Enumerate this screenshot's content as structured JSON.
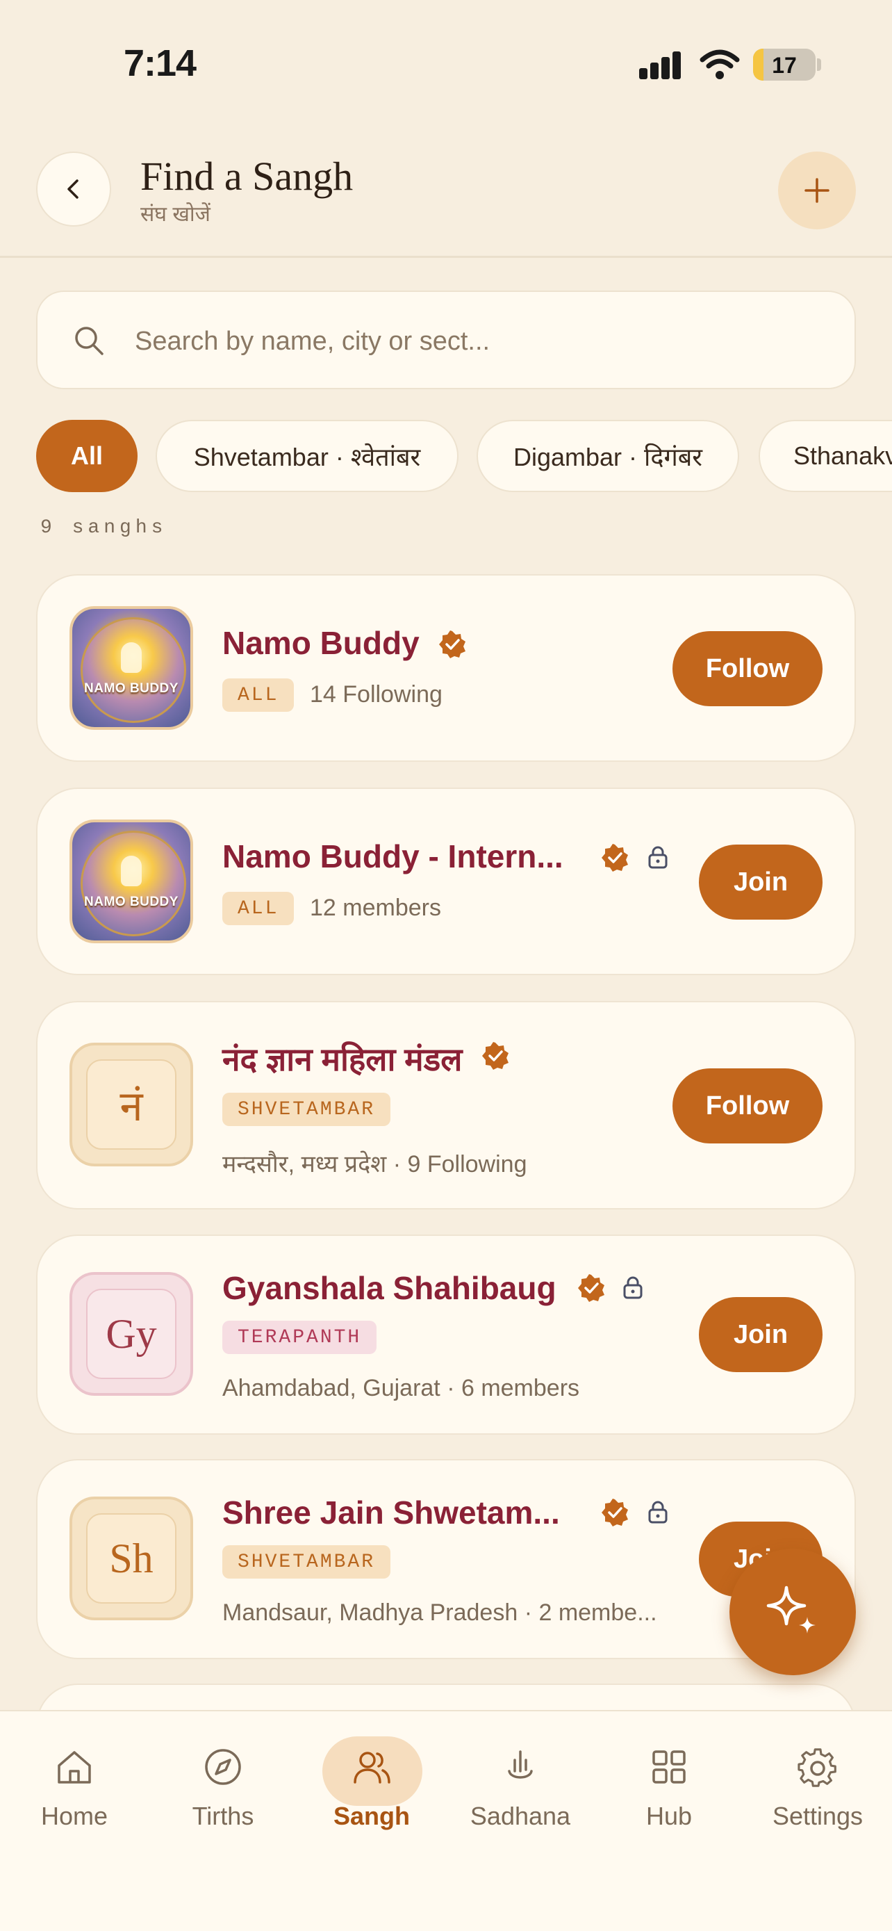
{
  "status_bar": {
    "time": "7:14",
    "battery": "17",
    "battery_level": 0.17
  },
  "header": {
    "title": "Find a Sangh",
    "subtitle": "संघ खोजें",
    "back_icon": "chevron-left-icon",
    "add_icon": "plus-icon"
  },
  "search": {
    "placeholder": "Search by name, city or sect...",
    "value": ""
  },
  "filters": [
    {
      "label": "All",
      "active": true
    },
    {
      "label": "Shvetambar · श्वेतांबर",
      "active": false
    },
    {
      "label": "Digambar · दिगंबर",
      "active": false
    },
    {
      "label": "Sthanakv",
      "active": false
    }
  ],
  "count_label": "9 sanghs",
  "sanghs": [
    {
      "name": "Namo Buddy",
      "avatar_caption": "NAMO BUDDY",
      "tag": "ALL",
      "meta": "14 Following",
      "action": "Follow",
      "verified": true,
      "locked": false
    },
    {
      "name": "Namo Buddy - Intern...",
      "avatar_caption": "NAMO BUDDY",
      "tag": "ALL",
      "meta": "12 members",
      "action": "Join",
      "verified": true,
      "locked": true
    },
    {
      "name": "नंद ज्ञान महिला मंडल",
      "avatar_letter": "नं",
      "tag": "SHVETAMBAR",
      "meta": "मन्दसौर, मध्य प्रदेश · 9 Following",
      "action": "Follow",
      "verified": true,
      "locked": false
    },
    {
      "name": "Gyanshala Shahibaug",
      "avatar_letter": "Gy",
      "tag": "TERAPANTH",
      "meta": "Ahamdabad, Gujarat · 6 members",
      "action": "Join",
      "verified": true,
      "locked": true
    },
    {
      "name": "Shree Jain Shwetam...",
      "avatar_letter": "Sh",
      "tag": "SHVETAMBAR",
      "meta": "Mandsaur, Madhya Pradesh · 2 membe...",
      "action": "Join",
      "verified": true,
      "locked": true
    }
  ],
  "fab": {
    "icon": "sparkle-icon"
  },
  "bottom_nav": [
    {
      "label": "Home",
      "icon": "home-icon",
      "active": false
    },
    {
      "label": "Tirths",
      "icon": "compass-icon",
      "active": false
    },
    {
      "label": "Sangh",
      "icon": "users-icon",
      "active": true
    },
    {
      "label": "Sadhana",
      "icon": "diya-icon",
      "active": false
    },
    {
      "label": "Hub",
      "icon": "grid-icon",
      "active": false
    },
    {
      "label": "Settings",
      "icon": "gear-icon",
      "active": false
    }
  ],
  "colors": {
    "accent": "#C2661C",
    "background": "#F7EEDF",
    "card": "#FFFAF0",
    "name_text": "#8A2136",
    "active_nav": "#A85412"
  }
}
